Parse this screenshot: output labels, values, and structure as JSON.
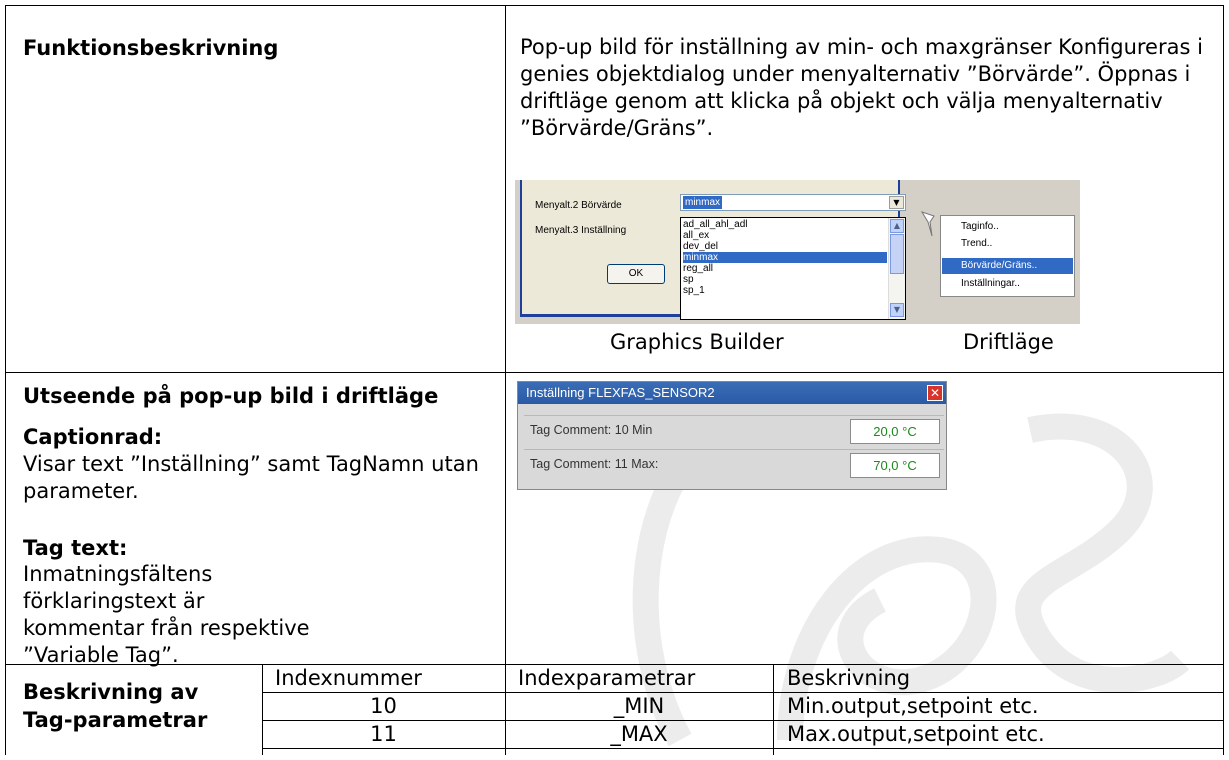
{
  "row1": {
    "heading": "Funktionsbeskrivning",
    "description": "Pop-up bild för inställning av min- och maxgränser Konfigureras i genies objektdialog under menyalternativ ”Börvärde”. Öppnas i driftläge genom att klicka på objekt och välja menyalternativ ”Börvärde/Gräns”.",
    "builder": {
      "label1": "Menyalt.2 Börvärde",
      "label2": "Menyalt.3 Inställning",
      "combo_value": "minmax",
      "list_items": [
        "ad_all_ahl_adl",
        "all_ex",
        "dev_del",
        "minmax",
        "reg_all",
        "sp",
        "sp_1"
      ],
      "selected_item": "minmax",
      "ok_label": "OK"
    },
    "runtime_menu": {
      "items": [
        "Taginfo..",
        "Trend..",
        "Börvärde/Gräns..",
        "Inställningar.."
      ],
      "selected": "Börvärde/Gräns.."
    },
    "caption_builder": "Graphics Builder",
    "caption_runtime": "Driftläge"
  },
  "row2": {
    "heading": "Utseende på pop-up bild i driftläge",
    "caption_heading": "Captionrad:",
    "caption_text": "Visar text ”Inställning” samt TagNamn utan parameter.",
    "tagtext_heading": "Tag text:",
    "tagtext_text": "Inmatningsfältens förklaringstext är kommentar från respektive ”Variable Tag”.",
    "popup": {
      "title": "Inställning FLEXFAS_SENSOR2",
      "rows": [
        {
          "label": "Tag Comment: 10 Min",
          "value": "20,0 °C"
        },
        {
          "label": "Tag Comment: 11 Max:",
          "value": "70,0 °C"
        }
      ]
    }
  },
  "row3": {
    "heading_line1": "Beskrivning av",
    "heading_line2": "Tag-parametrar",
    "columns": [
      "Indexnummer",
      "Indexparametrar",
      "Beskrivning"
    ],
    "rows": [
      [
        "10",
        "_MIN",
        "Min.output,setpoint etc."
      ],
      [
        "11",
        "_MAX",
        "Max.output,setpoint etc."
      ]
    ]
  }
}
